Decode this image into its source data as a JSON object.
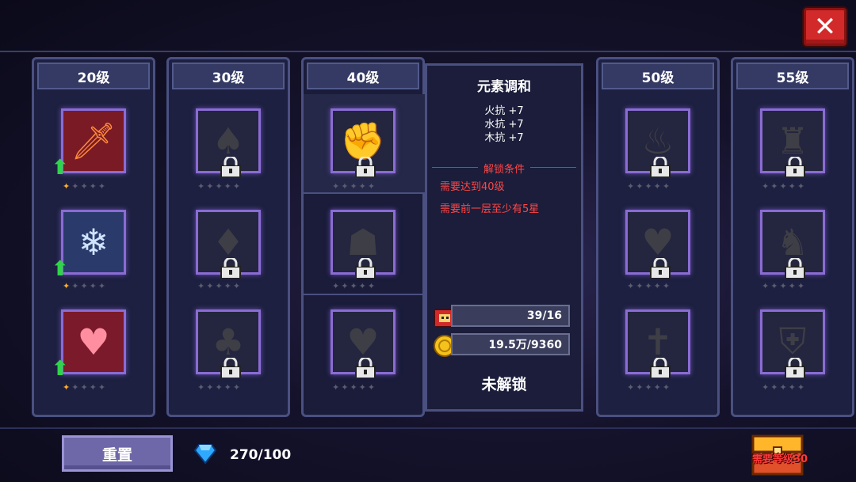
{
  "close_label": "✕",
  "columns": [
    {
      "header": "20级"
    },
    {
      "header": "30级"
    },
    {
      "header": "40级"
    },
    {
      "header": "50级"
    },
    {
      "header": "55级"
    }
  ],
  "detail": {
    "name": "元素调和",
    "stats": [
      "火抗 +7",
      "水抗 +7",
      "木抗 +7"
    ],
    "unlock_title": "解锁条件",
    "requirements": [
      "需要达到40级",
      "需要前一层至少有5星"
    ],
    "level_cost": "39/16",
    "gold_cost": "19.5万/9360",
    "status": "未解锁"
  },
  "footer": {
    "reset_label": "重置",
    "gems": "270/100",
    "chest_label": "需要等级30"
  },
  "colors": {
    "accent_purple": "#8a6cd4",
    "warning_red": "#ff4646",
    "upgrade_green": "#2fd44a"
  }
}
